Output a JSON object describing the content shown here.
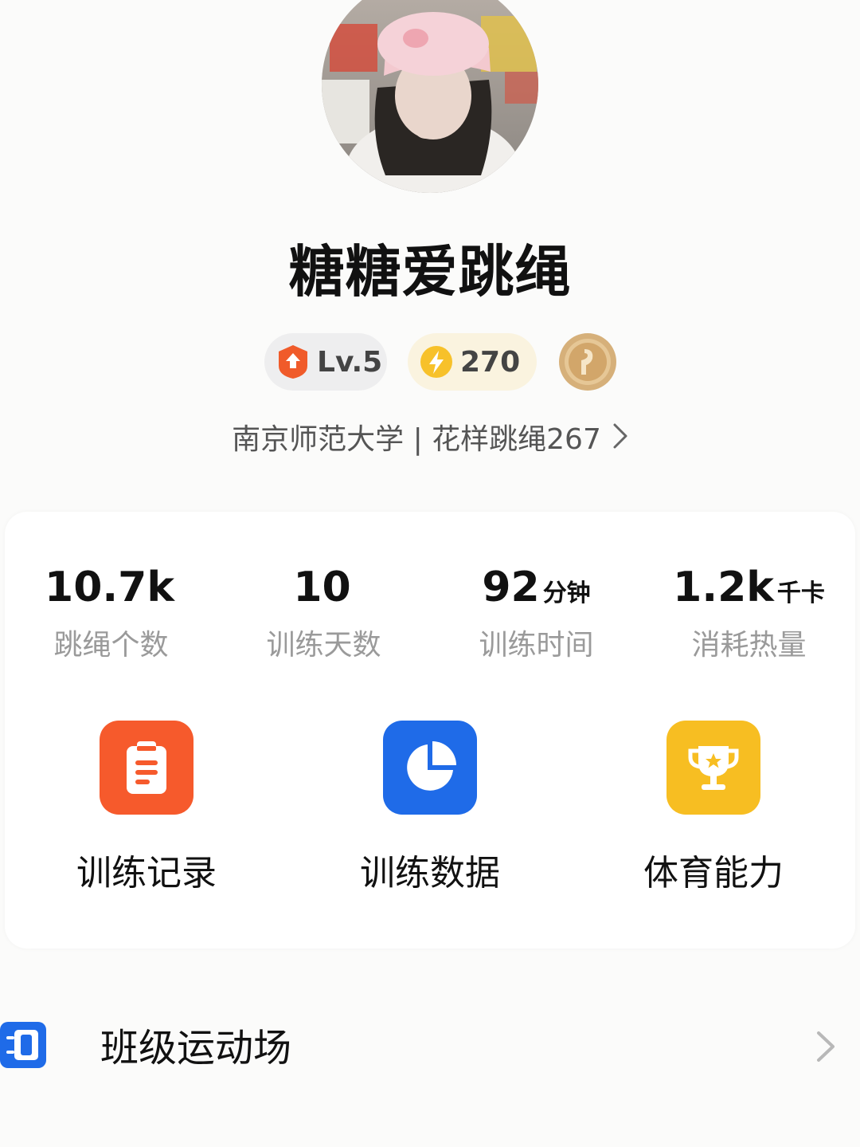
{
  "profile": {
    "username": "糖糖爱跳绳",
    "level_label": "Lv.5",
    "energy_value": "270",
    "school_line": "南京师范大学 | 花样跳绳267"
  },
  "stats": [
    {
      "value": "10.7k",
      "unit": "",
      "label": "跳绳个数"
    },
    {
      "value": "10",
      "unit": "",
      "label": "训练天数"
    },
    {
      "value": "92",
      "unit": "分钟",
      "label": "训练时间"
    },
    {
      "value": "1.2k",
      "unit": "千卡",
      "label": "消耗热量"
    }
  ],
  "tools": [
    {
      "label": "训练记录",
      "icon": "clipboard-icon",
      "color": "#f65a2c"
    },
    {
      "label": "训练数据",
      "icon": "pie-chart-icon",
      "color": "#1f6be8"
    },
    {
      "label": "体育能力",
      "icon": "trophy-icon",
      "color": "#f7be22"
    }
  ],
  "menu": {
    "class_playground_label": "班级运动场",
    "class_playground_icon": "notebook-icon"
  },
  "colors": {
    "level_badge": "#f05b2a",
    "energy_badge": "#f7c12a",
    "medal": "#d8b27a",
    "label_gray": "#9a9a9a"
  }
}
